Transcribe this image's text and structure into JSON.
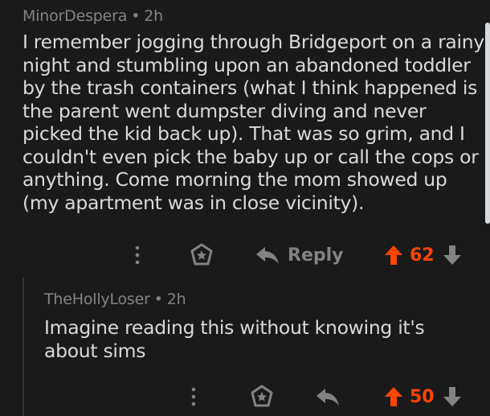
{
  "colors": {
    "background": "#1a1a1b",
    "text": "#d7dadc",
    "muted": "#818384",
    "upvote": "#ff4500"
  },
  "comments": [
    {
      "author": "MinorDespera",
      "separator": "•",
      "age": "2h",
      "body": "I remember jogging through Bridgeport on a rainy night and stumbling upon an abandoned toddler by the trash containers (what I think happened is the parent went dumpster diving and never picked the kid back up). That was so grim, and I couldn't even pick the baby up or call the cops or anything. Come morning the mom showed up (my apartment was in close vicinity).",
      "reply_label": "Reply",
      "score": "62",
      "icons": [
        "more-vertical-icon",
        "award-icon",
        "reply-arrow-icon",
        "upvote-arrow-icon",
        "downvote-arrow-icon"
      ]
    },
    {
      "author": "TheHollyLoser",
      "separator": "•",
      "age": "2h",
      "body": "Imagine reading this without knowing it's about sims",
      "reply_label": "",
      "score": "50",
      "icons": [
        "more-vertical-icon",
        "award-icon",
        "reply-arrow-icon",
        "upvote-arrow-icon",
        "downvote-arrow-icon"
      ]
    }
  ]
}
